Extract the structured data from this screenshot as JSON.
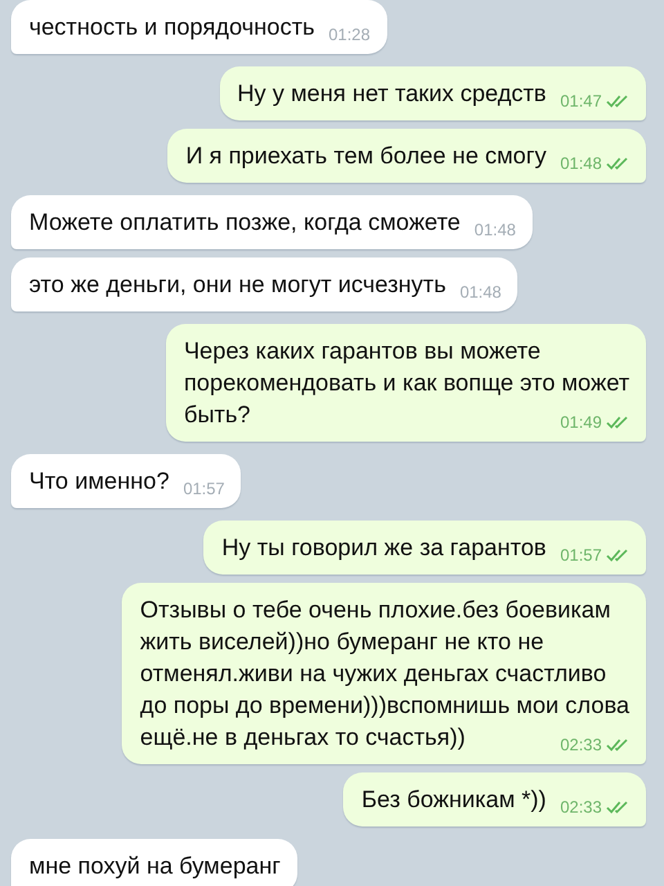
{
  "messages": [
    {
      "outgoing": false,
      "lines": [
        "честность и порядочность"
      ],
      "time": "01:28"
    },
    {
      "outgoing": true,
      "lines": [
        "Ну у меня нет таких средств"
      ],
      "time": "01:47",
      "read": true
    },
    {
      "outgoing": true,
      "lines": [
        "И я приехать тем более не смогу"
      ],
      "time": "01:48",
      "read": true
    },
    {
      "outgoing": false,
      "lines": [
        "Можете оплатить позже, когда сможете"
      ],
      "time": "01:48"
    },
    {
      "outgoing": false,
      "lines": [
        "это же деньги, они не могут исчезнуть"
      ],
      "time": "01:48"
    },
    {
      "outgoing": true,
      "lines": [
        "Через каких гарантов вы можете",
        "порекомендовать и как вопще это может",
        "быть?"
      ],
      "time": "01:49",
      "read": true
    },
    {
      "outgoing": false,
      "lines": [
        "Что именно?"
      ],
      "time": "01:57"
    },
    {
      "outgoing": true,
      "lines": [
        "Ну ты говорил же за гарантов"
      ],
      "time": "01:57",
      "read": true
    },
    {
      "outgoing": true,
      "lines": [
        "Отзывы о тебе очень плохие.без боевикам",
        "жить виселей))но бумеранг не кто не",
        "отменял.живи на чужих деньгах счастливо",
        "до поры до времени)))вспомнишь мои слова",
        "ещё.не в деньгах то счастья))"
      ],
      "time": "02:33",
      "read": true
    },
    {
      "outgoing": true,
      "lines": [
        "Без божникам *))"
      ],
      "time": "02:33",
      "read": true
    },
    {
      "outgoing": false,
      "lines": [
        "мне похуй на бумеранг"
      ]
    }
  ]
}
